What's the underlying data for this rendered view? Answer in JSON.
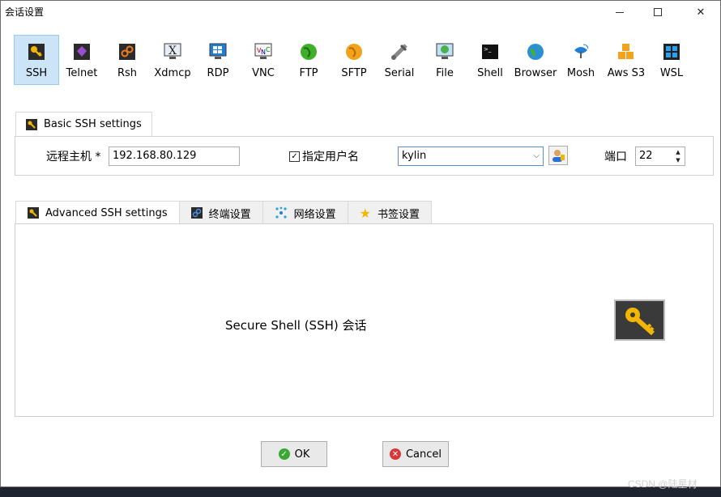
{
  "window": {
    "title": "会话设置"
  },
  "toolbar": [
    {
      "label": "SSH",
      "icon": "ssh-key-icon",
      "selected": true
    },
    {
      "label": "Telnet",
      "icon": "telnet-icon"
    },
    {
      "label": "Rsh",
      "icon": "rsh-icon"
    },
    {
      "label": "Xdmcp",
      "icon": "xdmcp-icon"
    },
    {
      "label": "RDP",
      "icon": "rdp-monitor-icon"
    },
    {
      "label": "VNC",
      "icon": "vnc-icon"
    },
    {
      "label": "FTP",
      "icon": "ftp-globe-icon"
    },
    {
      "label": "SFTP",
      "icon": "sftp-icon"
    },
    {
      "label": "Serial",
      "icon": "serial-plug-icon"
    },
    {
      "label": "File",
      "icon": "file-monitor-icon"
    },
    {
      "label": "Shell",
      "icon": "shell-terminal-icon"
    },
    {
      "label": "Browser",
      "icon": "browser-globe-icon"
    },
    {
      "label": "Mosh",
      "icon": "mosh-satellite-icon"
    },
    {
      "label": "Aws S3",
      "icon": "aws-s3-cubes-icon"
    },
    {
      "label": "WSL",
      "icon": "wsl-windows-icon"
    }
  ],
  "basic_tab": {
    "label": "Basic SSH settings"
  },
  "basic": {
    "host_label": "远程主机 *",
    "host_value": "192.168.80.129",
    "specify_user_label": "指定用户名",
    "specify_user_checked": true,
    "username_value": "kylin",
    "port_label": "端口",
    "port_value": "22"
  },
  "sub_tabs": [
    {
      "label": "Advanced SSH settings",
      "icon": "key-icon"
    },
    {
      "label": "终端设置",
      "icon": "terminal-settings-icon"
    },
    {
      "label": "网络设置",
      "icon": "network-icon"
    },
    {
      "label": "书签设置",
      "icon": "star-icon"
    }
  ],
  "description": "Secure Shell (SSH) 会话",
  "buttons": {
    "ok": "OK",
    "cancel": "Cancel"
  },
  "watermark": "CSDN @陆星材",
  "colors": {
    "selected_bg": "#cce4f7",
    "ok_green": "#3aa832",
    "cancel_red": "#d9373a",
    "key_yellow": "#f2b705"
  }
}
